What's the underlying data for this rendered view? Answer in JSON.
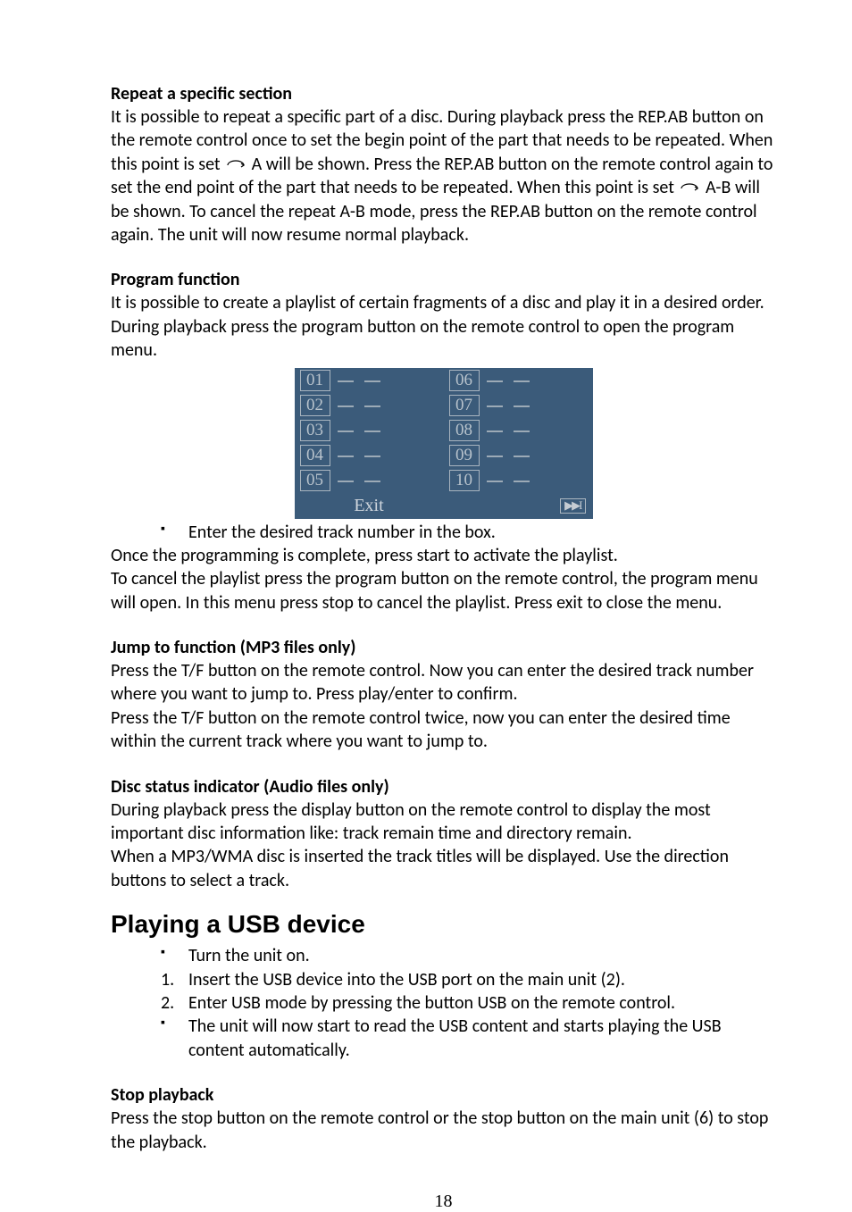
{
  "repeat_section": {
    "heading": "Repeat a specific section",
    "text_before_icon1": "It is possible to repeat a specific part of a disc. During playback press the REP.AB button on the remote control once to set the begin point of the part that needs to be repeated. When this point is set ",
    "text_after_icon1": " A will be shown. Press the REP.AB button on the remote control again to set the end point of the part that needs to be repeated. When this point is set ",
    "text_after_icon2": " A-B will be shown. To cancel the repeat A-B mode, press the REP.AB button on the remote control again. The unit will now resume normal playback."
  },
  "program_section": {
    "heading": "Program function",
    "intro": "It is possible to create a playlist of certain fragments of a disc and play it in a desired order. During playback press the program button on the remote control to open the program menu.",
    "slots_left": [
      "01",
      "02",
      "03",
      "04",
      "05"
    ],
    "slots_right": [
      "06",
      "07",
      "08",
      "09",
      "10"
    ],
    "exit_label": "Exit",
    "next_label": "▶▶I",
    "bullet1": "Enter the desired track number in the box.",
    "after_bullet1": "Once the programming is complete, press start to activate the playlist.",
    "after_bullet2": "To cancel the playlist press the program button on the remote control, the program menu will open. In this menu press stop to cancel the playlist. Press exit to close the menu."
  },
  "jump_section": {
    "heading": "Jump to function (MP3 files only)",
    "p1": "Press the T/F button on the remote control. Now you can enter the desired track number where you want to jump to. Press play/enter to confirm.",
    "p2": "Press the T/F button on the remote control twice, now you can enter the desired time within the current track where you want to jump to."
  },
  "disc_section": {
    "heading": "Disc status indicator (Audio files only)",
    "p1": "During playback press the display button on the remote control to display the most important disc information like: track remain time and directory remain.",
    "p2": "When a MP3/WMA disc is inserted the track titles will be displayed. Use the direction buttons to select a track."
  },
  "usb_section": {
    "heading": "Playing a USB device",
    "bullet1": "Turn the unit on.",
    "num1": "Insert the USB device into the USB port on the main unit (2).",
    "num2": "Enter USB mode by pressing the button USB on the remote control.",
    "bullet2": "The unit will now start to read the USB content and starts playing the USB content automatically."
  },
  "stop_section": {
    "heading": "Stop playback",
    "text": "Press the stop button on the remote control or the stop button on the main unit (6) to stop the playback."
  },
  "page_number": "18"
}
